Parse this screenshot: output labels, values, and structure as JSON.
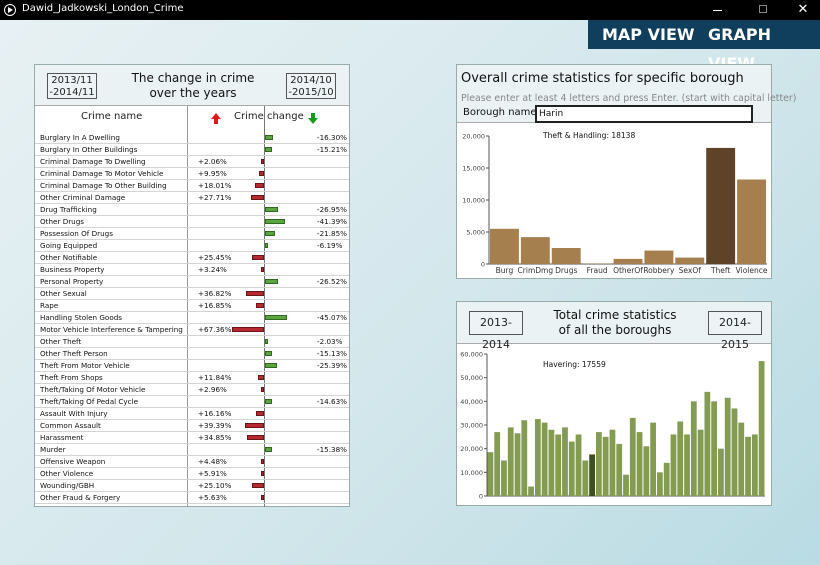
{
  "window": {
    "title": "Dawid_Jadkowski_London_Crime",
    "minimize_icon": "minimize-icon",
    "maximize_icon": "maximize-icon",
    "close_icon": "close-icon",
    "close_glyph": "✕"
  },
  "tabs": {
    "map": "MAP VIEW",
    "graph": "GRAPH VIEW"
  },
  "change_panel": {
    "title_line1": "The change in crime",
    "title_line2": "over the years",
    "left_year_line1": "2013/11",
    "left_year_line2": "-2014/11",
    "right_year_line1": "2014/10",
    "right_year_line2": "-2015/10",
    "col_name": "Crime name",
    "col_change": "Crime change",
    "up_color": "#e31a1a",
    "down_color": "#1a9a1a",
    "rows": [
      {
        "name": "Burglary In A Dwelling",
        "change": -16.3,
        "label": "-16.30%"
      },
      {
        "name": "Burglary In Other Buildings",
        "change": -15.21,
        "label": "-15.21%"
      },
      {
        "name": "Criminal Damage To Dwelling",
        "change": 2.06,
        "label": "+2.06%"
      },
      {
        "name": "Criminal Damage To Motor Vehicle",
        "change": 9.95,
        "label": "+9.95%"
      },
      {
        "name": "Criminal Damage To Other Building",
        "change": 18.01,
        "label": "+18.01%"
      },
      {
        "name": "Other Criminal Damage",
        "change": 27.71,
        "label": "+27.71%"
      },
      {
        "name": "Drug Trafficking",
        "change": -26.95,
        "label": "-26.95%"
      },
      {
        "name": "Other Drugs",
        "change": -41.39,
        "label": "-41.39%"
      },
      {
        "name": "Possession Of Drugs",
        "change": -21.85,
        "label": "-21.85%"
      },
      {
        "name": "Going Equipped",
        "change": -6.19,
        "label": "-6.19%"
      },
      {
        "name": "Other Notifiable",
        "change": 25.45,
        "label": "+25.45%"
      },
      {
        "name": "Business Property",
        "change": 3.24,
        "label": "+3.24%"
      },
      {
        "name": "Personal Property",
        "change": -26.52,
        "label": "-26.52%"
      },
      {
        "name": "Other Sexual",
        "change": 36.82,
        "label": "+36.82%"
      },
      {
        "name": "Rape",
        "change": 16.85,
        "label": "+16.85%"
      },
      {
        "name": "Handling Stolen Goods",
        "change": -45.07,
        "label": "-45.07%"
      },
      {
        "name": "Motor Vehicle Interference & Tampering",
        "change": 67.36,
        "label": "+67.36%"
      },
      {
        "name": "Other Theft",
        "change": -2.03,
        "label": "-2.03%"
      },
      {
        "name": "Other Theft Person",
        "change": -15.13,
        "label": "-15.13%"
      },
      {
        "name": "Theft From Motor Vehicle",
        "change": -25.39,
        "label": "-25.39%"
      },
      {
        "name": "Theft From Shops",
        "change": 11.84,
        "label": "+11.84%"
      },
      {
        "name": "Theft/Taking Of Motor Vehicle",
        "change": 2.96,
        "label": "+2.96%"
      },
      {
        "name": "Theft/Taking Of Pedal Cycle",
        "change": -14.63,
        "label": "-14.63%"
      },
      {
        "name": "Assault With Injury",
        "change": 16.16,
        "label": "+16.16%"
      },
      {
        "name": "Common Assault",
        "change": 39.39,
        "label": "+39.39%"
      },
      {
        "name": "Harassment",
        "change": 34.85,
        "label": "+34.85%"
      },
      {
        "name": "Murder",
        "change": -15.38,
        "label": "-15.38%"
      },
      {
        "name": "Offensive Weapon",
        "change": 4.48,
        "label": "+4.48%"
      },
      {
        "name": "Other Violence",
        "change": 5.91,
        "label": "+5.91%"
      },
      {
        "name": "Wounding/GBH",
        "change": 25.1,
        "label": "+25.10%"
      },
      {
        "name": "Other Fraud & Forgery",
        "change": 5.63,
        "label": "+5.63%"
      }
    ]
  },
  "borough_panel": {
    "title": "Overall crime statistics for specific borough",
    "hint": "Please enter at least 4 letters and press Enter. (start with capital letter)",
    "label": "Borough name:",
    "input_value": "Harin"
  },
  "total_panel": {
    "title_line1": "Total crime statistics",
    "title_line2": "of all the boroughs",
    "left_year": "2013-2014",
    "right_year": "2014-2015"
  },
  "chart_data": [
    {
      "type": "bar",
      "categories": [
        "Burg",
        "CrimDmg",
        "Drugs",
        "Fraud",
        "OtherOf",
        "Robbery",
        "SexOf",
        "Theft",
        "Violence"
      ],
      "values": [
        5500,
        4200,
        2500,
        50,
        800,
        2100,
        1000,
        18138,
        13200
      ],
      "ylim": [
        0,
        20000
      ],
      "yticks": [
        0,
        5000,
        10000,
        15000,
        20000
      ],
      "ytick_labels": [
        "0",
        "5,000",
        "10,000",
        "15,000",
        "20,000"
      ],
      "highlight_index": 7,
      "annotation": "Theft & Handling: 18138",
      "color": "#a67f4e",
      "highlight_color": "#5e4328",
      "grid": false
    },
    {
      "type": "bar",
      "values": [
        18500,
        27000,
        15000,
        29000,
        26500,
        32000,
        4000,
        32500,
        31000,
        28000,
        26000,
        29000,
        23000,
        26000,
        15000,
        17559,
        27000,
        25000,
        28000,
        22000,
        9000,
        33000,
        27000,
        21000,
        31000,
        10000,
        14000,
        26000,
        31500,
        26000,
        40000,
        28000,
        44000,
        40000,
        20000,
        41500,
        37000,
        31000,
        25000,
        26000,
        57000
      ],
      "ylim": [
        0,
        60000
      ],
      "yticks": [
        0,
        10000,
        20000,
        30000,
        40000,
        50000,
        60000
      ],
      "ytick_labels": [
        "0",
        "10,000",
        "20,000",
        "30,000",
        "40,000",
        "50,000",
        "60,000"
      ],
      "highlight_index": 15,
      "annotation": "Havering: 17559",
      "color": "#849b52",
      "highlight_color": "#3f4f22",
      "grid": false
    }
  ]
}
